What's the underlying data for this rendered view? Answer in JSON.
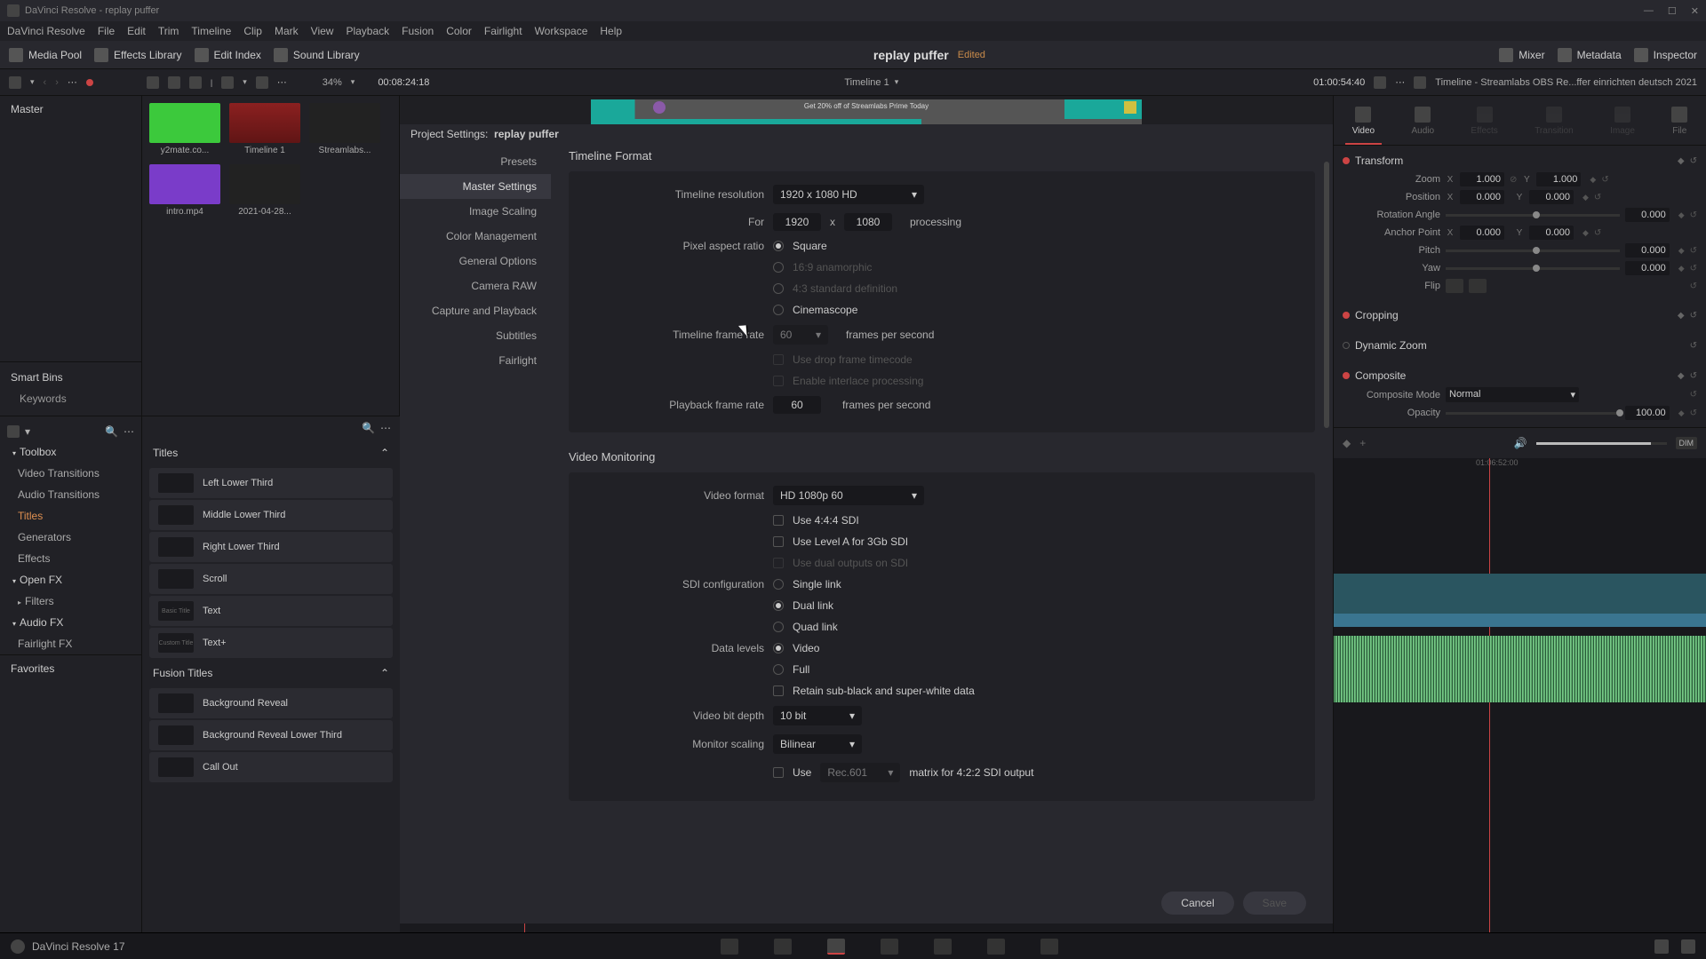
{
  "titlebar": {
    "text": "DaVinci Resolve - replay puffer"
  },
  "menubar": [
    "DaVinci Resolve",
    "File",
    "Edit",
    "Trim",
    "Timeline",
    "Clip",
    "Mark",
    "View",
    "Playback",
    "Fusion",
    "Color",
    "Fairlight",
    "Workspace",
    "Help"
  ],
  "toolbar": {
    "media_pool": "Media Pool",
    "effects_library": "Effects Library",
    "edit_index": "Edit Index",
    "sound_library": "Sound Library",
    "project_name": "replay puffer",
    "edited": "Edited",
    "mixer": "Mixer",
    "metadata": "Metadata",
    "inspector": "Inspector"
  },
  "secondbar": {
    "zoom": "34%",
    "left_tc": "00:08:24:18",
    "timeline_name": "Timeline 1",
    "right_tc": "01:00:54:40",
    "insp_title": "Timeline - Streamlabs OBS Re...ffer einrichten deutsch 2021"
  },
  "pool": {
    "master": "Master",
    "smartbins": "Smart Bins",
    "keywords": "Keywords"
  },
  "clips": [
    {
      "name": "y2mate.co...",
      "cls": "green"
    },
    {
      "name": "Timeline 1",
      "cls": "red"
    },
    {
      "name": "Streamlabs...",
      "cls": "dark"
    },
    {
      "name": "intro.mp4",
      "cls": "purple"
    },
    {
      "name": "2021-04-28...",
      "cls": "dark"
    }
  ],
  "fxnav": {
    "toolbox": "Toolbox",
    "video_t": "Video Transitions",
    "audio_t": "Audio Transitions",
    "titles": "Titles",
    "generators": "Generators",
    "effects": "Effects",
    "openfx": "Open FX",
    "filters": "Filters",
    "audiofx": "Audio FX",
    "fairlightfx": "Fairlight FX",
    "favorites": "Favorites"
  },
  "fxlist": {
    "titles_h": "Titles",
    "items": [
      "Left Lower Third",
      "Middle Lower Third",
      "Right Lower Third",
      "Scroll",
      "Text",
      "Text+"
    ],
    "thumbs": [
      "",
      "",
      "",
      "",
      "Basic Title",
      "Custom Title"
    ],
    "fusion_h": "Fusion Titles",
    "fusion_items": [
      "Background Reveal",
      "Background Reveal Lower Third",
      "Call Out"
    ]
  },
  "modal": {
    "title_prefix": "Project Settings:",
    "title_name": "replay puffer",
    "nav": [
      "Presets",
      "Master Settings",
      "Image Scaling",
      "Color Management",
      "General Options",
      "Camera RAW",
      "Capture and Playback",
      "Subtitles",
      "Fairlight"
    ],
    "timeline_format_h": "Timeline Format",
    "tl_res_lbl": "Timeline resolution",
    "tl_res_val": "1920 x 1080 HD",
    "for_lbl": "For",
    "for_w": "1920",
    "for_x": "x",
    "for_h": "1080",
    "processing": "processing",
    "par_lbl": "Pixel aspect ratio",
    "par_square": "Square",
    "par_169": "16:9 anamorphic",
    "par_43": "4:3 standard definition",
    "par_cin": "Cinemascope",
    "tfr_lbl": "Timeline frame rate",
    "tfr_val": "60",
    "fps": "frames per second",
    "drop": "Use drop frame timecode",
    "interlace": "Enable interlace processing",
    "pfr_lbl": "Playback frame rate",
    "pfr_val": "60",
    "vm_h": "Video Monitoring",
    "vf_lbl": "Video format",
    "vf_val": "HD 1080p 60",
    "use444": "Use 4:4:4 SDI",
    "levela": "Use Level A for 3Gb SDI",
    "dual_out": "Use dual outputs on SDI",
    "sdi_lbl": "SDI configuration",
    "single": "Single link",
    "dual": "Dual link",
    "quad": "Quad link",
    "dl_lbl": "Data levels",
    "video": "Video",
    "full": "Full",
    "retain": "Retain sub-black and super-white data",
    "vbd_lbl": "Video bit depth",
    "vbd_val": "10 bit",
    "ms_lbl": "Monitor scaling",
    "ms_val": "Bilinear",
    "matrix_use": "Use",
    "matrix_rec": "Rec.601",
    "matrix_txt": "matrix for 4:2:2 SDI output",
    "cancel": "Cancel",
    "save": "Save"
  },
  "inspector": {
    "tabs": [
      "Video",
      "Audio",
      "Effects",
      "Transition",
      "Image",
      "File"
    ],
    "transform": "Transform",
    "zoom_lbl": "Zoom",
    "zoom_x": "1.000",
    "zoom_y": "1.000",
    "pos_lbl": "Position",
    "pos_x": "0.000",
    "pos_y": "0.000",
    "rot_lbl": "Rotation Angle",
    "rot_v": "0.000",
    "anchor_lbl": "Anchor Point",
    "anchor_x": "0.000",
    "anchor_y": "0.000",
    "pitch_lbl": "Pitch",
    "pitch_v": "0.000",
    "yaw_lbl": "Yaw",
    "yaw_v": "0.000",
    "flip_lbl": "Flip",
    "cropping": "Cropping",
    "dynzoom": "Dynamic Zoom",
    "composite": "Composite",
    "comp_mode_lbl": "Composite Mode",
    "comp_mode_val": "Normal",
    "opacity_lbl": "Opacity",
    "opacity_val": "100.00",
    "tc": "01:06:52:00"
  },
  "preview": {
    "promo": "Get 20% off of Streamlabs Prime Today"
  },
  "bottombar": {
    "appname": "DaVinci Resolve 17"
  }
}
